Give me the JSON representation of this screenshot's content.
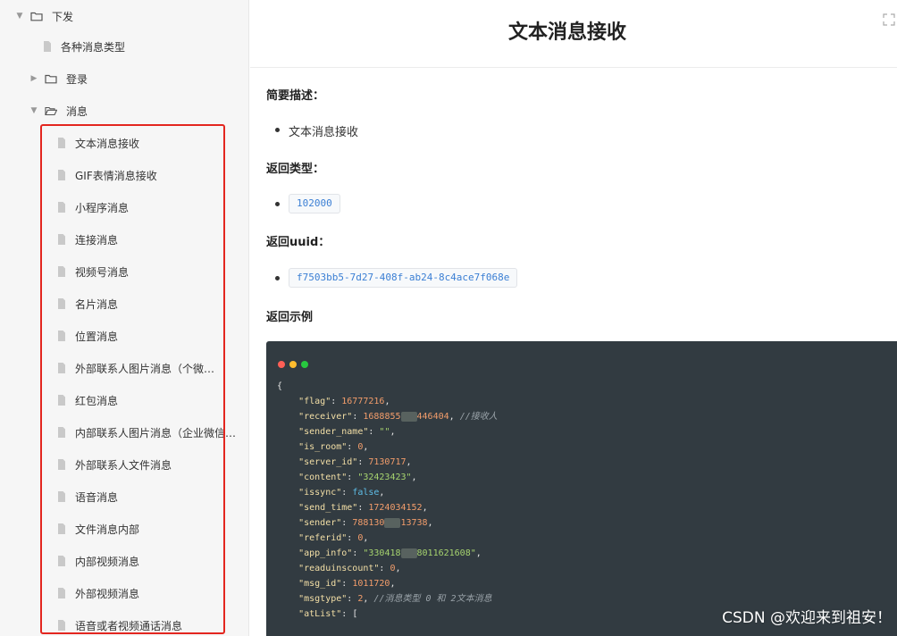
{
  "sidebar": {
    "top_folder": {
      "label": "下发"
    },
    "msg_types_doc": {
      "label": "各种消息类型"
    },
    "login_folder": {
      "label": "登录"
    },
    "message_folder": {
      "label": "消息"
    },
    "message_items": [
      {
        "label": "文本消息接收"
      },
      {
        "label": "GIF表情消息接收"
      },
      {
        "label": "小程序消息"
      },
      {
        "label": "连接消息"
      },
      {
        "label": "视频号消息"
      },
      {
        "label": "名片消息"
      },
      {
        "label": "位置消息"
      },
      {
        "label": "外部联系人图片消息（个微发的）"
      },
      {
        "label": "红包消息"
      },
      {
        "label": "内部联系人图片消息（企业微信用..."
      },
      {
        "label": "外部联系人文件消息"
      },
      {
        "label": "语音消息"
      },
      {
        "label": "文件消息内部"
      },
      {
        "label": "内部视频消息"
      },
      {
        "label": "外部视频消息"
      },
      {
        "label": "语音或者视频通话消息"
      }
    ]
  },
  "main": {
    "title": "文本消息接收",
    "summary_heading": "简要描述：",
    "summary_item": "文本消息接收",
    "return_type_heading": "返回类型：",
    "return_type_value": "102000",
    "return_uuid_heading": "返回uuid：",
    "return_uuid_value": "f7503bb5-7d27-408f-ab24-8c4ace7f068e",
    "example_heading": "返回示例"
  },
  "code": {
    "open_brace": "{",
    "lines": [
      {
        "key": "\"flag\"",
        "value": "16777216",
        "type": "number",
        "comment": ""
      },
      {
        "key": "\"receiver\"",
        "value_pre": "1688855",
        "value_post": "446404",
        "type": "number-masked",
        "comment": "//接收人"
      },
      {
        "key": "\"sender_name\"",
        "value": "\"\"",
        "type": "string",
        "comment": ""
      },
      {
        "key": "\"is_room\"",
        "value": "0",
        "type": "number",
        "comment": ""
      },
      {
        "key": "\"server_id\"",
        "value": "7130717",
        "type": "number",
        "comment": ""
      },
      {
        "key": "\"content\"",
        "value": "\"32423423\"",
        "type": "string",
        "comment": ""
      },
      {
        "key": "\"issync\"",
        "value": "false",
        "type": "bool",
        "comment": ""
      },
      {
        "key": "\"send_time\"",
        "value": "1724034152",
        "type": "number",
        "comment": ""
      },
      {
        "key": "\"sender\"",
        "value_pre": "788130",
        "value_post": "13738",
        "type": "number-masked",
        "comment": ""
      },
      {
        "key": "\"referid\"",
        "value": "0",
        "type": "number",
        "comment": ""
      },
      {
        "key": "\"app_info\"",
        "value_pre": "\"330418",
        "value_post": "8011621608\"",
        "type": "string-masked",
        "comment": ""
      },
      {
        "key": "\"readuinscount\"",
        "value": "0",
        "type": "number",
        "comment": ""
      },
      {
        "key": "\"msg_id\"",
        "value": "1011720",
        "type": "number",
        "comment": ""
      },
      {
        "key": "\"msgtype\"",
        "value": "2",
        "type": "number",
        "comment": "//消息类型 0 和 2文本消息"
      },
      {
        "key": "\"atList\"",
        "value": "[",
        "type": "open",
        "comment": ""
      }
    ]
  },
  "watermark": "CSDN @欢迎来到祖安！",
  "colors": {
    "highlight_border": "#e3261f",
    "dot_red": "#ff5f56",
    "dot_yellow": "#ffbd2e",
    "dot_green": "#27c93f",
    "code_bg": "#323b41"
  }
}
